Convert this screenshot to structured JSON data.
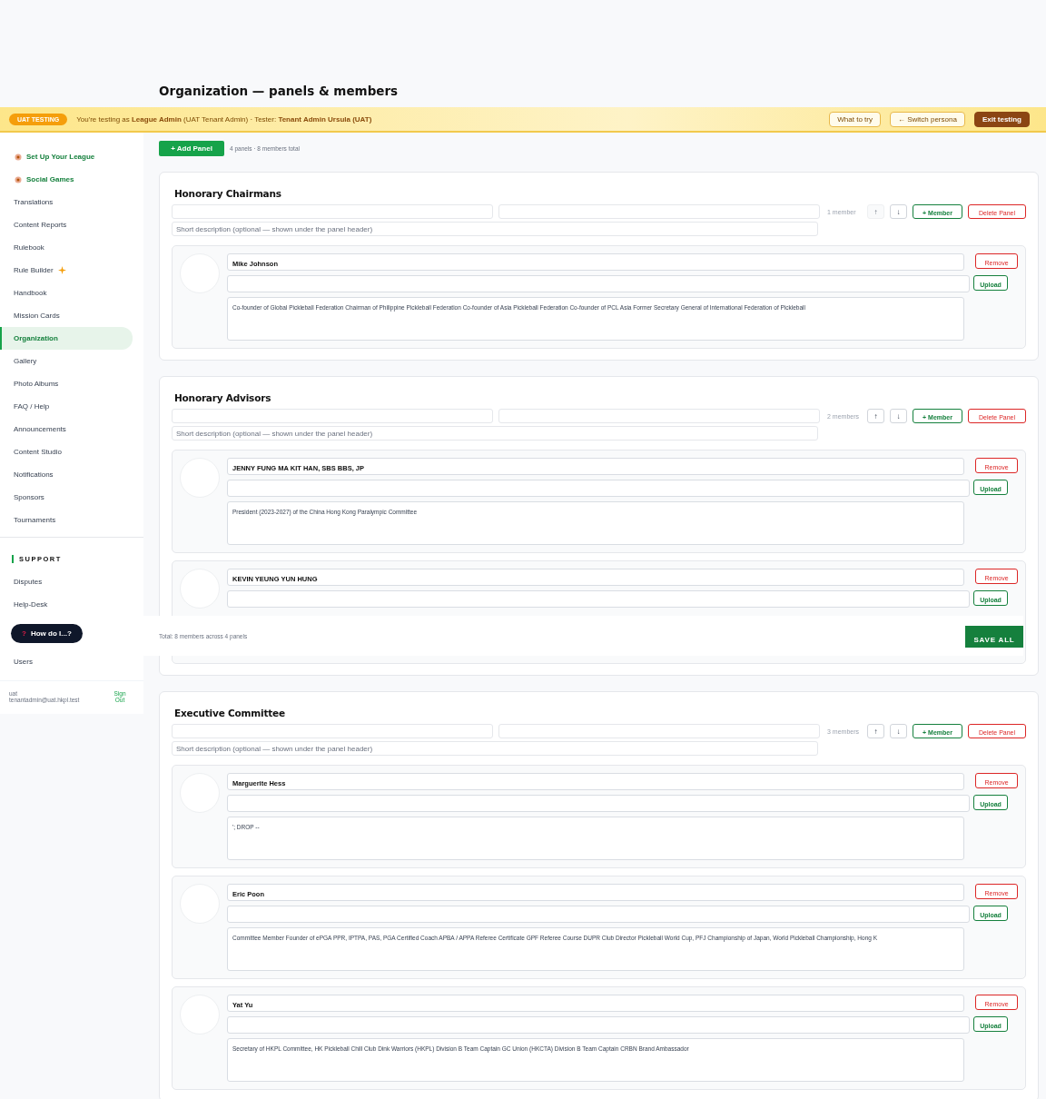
{
  "page_title": "Organization — panels & members",
  "uat_banner": {
    "badge": "UAT TESTING",
    "message": "You're testing as **League Admin** (UAT Tenant Admin) · Tester: **Tenant Admin Ursula (UAT)**",
    "buttons": [
      {
        "label": "What to try",
        "kind": "outline"
      },
      {
        "label": "← Switch persona",
        "kind": "outline"
      },
      {
        "label": "Exit testing",
        "kind": "primary"
      }
    ]
  },
  "sidebar": {
    "items": [
      {
        "label": "Set Up Your League",
        "kind": "feature",
        "selected": false
      },
      {
        "label": "Social Games",
        "kind": "feature",
        "selected": false
      },
      {
        "label": "Translations",
        "kind": "link",
        "selected": false
      },
      {
        "label": "Content Reports",
        "kind": "link",
        "selected": false
      },
      {
        "label": "Rulebook",
        "kind": "link",
        "selected": false
      },
      {
        "label": "Rule Builder",
        "kind": "sparkle",
        "selected": false
      },
      {
        "label": "Handbook",
        "kind": "link",
        "selected": false
      },
      {
        "label": "Mission Cards",
        "kind": "link",
        "selected": false
      },
      {
        "label": "Organization",
        "kind": "link",
        "selected": true
      },
      {
        "label": "Gallery",
        "kind": "link",
        "selected": false
      },
      {
        "label": "Photo Albums",
        "kind": "link",
        "selected": false
      },
      {
        "label": "FAQ / Help",
        "kind": "link",
        "selected": false
      },
      {
        "label": "Announcements",
        "kind": "link",
        "selected": false
      },
      {
        "label": "Content Studio",
        "kind": "link",
        "selected": false
      },
      {
        "label": "Notifications",
        "kind": "link",
        "selected": false
      },
      {
        "label": "Sponsors",
        "kind": "link",
        "selected": false
      },
      {
        "label": "Tournaments",
        "kind": "link",
        "selected": false
      }
    ],
    "support_heading": "SUPPORT",
    "support_items": [
      {
        "label": "Disputes",
        "selected": false
      },
      {
        "label": "Help-Desk",
        "selected": false
      }
    ],
    "help_button": {
      "icon": "?",
      "label": "How do I...?"
    },
    "footer_items": [
      {
        "label": "Users",
        "selected": false
      }
    ],
    "user": {
      "name": "uat",
      "email": "tenantadmin@uat.hkpl.test"
    },
    "sign_out": "Sign Out"
  },
  "toolbar": {
    "add_button": "+ Add Panel",
    "summary": "4 panels · 8 members total"
  },
  "panels": [
    {
      "title": "Honorary Chairmans",
      "description_placeholder": "Short description (optional — shown under the panel header)",
      "count": "1 member",
      "move_up": {
        "label": "↑",
        "disabled": true
      },
      "move_down": {
        "label": "↓",
        "disabled": false
      },
      "add_member": "+ Member",
      "delete": "Delete Panel",
      "members": [
        {
          "name": "Mike Johnson",
          "upload": "Upload",
          "remove": "Remove",
          "bio": "Co-founder of Global Pickleball Federation Chairman of Philippine Pickleball Federation Co-founder of Asia Pickleball Federation Co-founder of PCL Asia Former Secretary General of International Federation of Pickleball"
        }
      ]
    },
    {
      "title": "Honorary Advisors",
      "description_placeholder": "Short description (optional — shown under the panel header)",
      "count": "2 members",
      "move_up": {
        "label": "↑",
        "disabled": false
      },
      "move_down": {
        "label": "↓",
        "disabled": false
      },
      "add_member": "+ Member",
      "delete": "Delete Panel",
      "members": [
        {
          "name": "JENNY FUNG MA KIT HAN, SBS BBS, JP",
          "upload": "Upload",
          "remove": "Remove",
          "bio": "President (2023-2027) of the China Hong Kong Paralympic Committee"
        },
        {
          "name": "KEVIN YEUNG YUN HUNG",
          "upload": "Upload",
          "remove": "Remove"
        }
      ]
    },
    {
      "title": "Executive Committee",
      "description_placeholder": "Short description (optional — shown under the panel header)",
      "count": "3 members",
      "move_up": {
        "label": "↑",
        "disabled": false
      },
      "move_down": {
        "label": "↓",
        "disabled": false
      },
      "add_member": "+ Member",
      "delete": "Delete Panel",
      "members": [
        {
          "name": "Marguerite Hess",
          "upload": "Upload",
          "remove": "Remove",
          "bio": "'; DROP --"
        },
        {
          "name": "Eric Poon",
          "upload": "Upload",
          "remove": "Remove",
          "bio": "Committee Member Founder of ePGA PPR, IPTPA, PAS, PGA Certified Coach APBA / APPA Referee Certificate GPF Referee Course DUPR Club Director Pickleball World Cup, PFJ Championship of Japan, World Pickleball Championship, Hong K"
        },
        {
          "name": "Yat Yu",
          "upload": "Upload",
          "remove": "Remove",
          "bio": "Secretary of HKPL Committee, HK Pickleball Chill Club Dink Warriors (HKPL) Division B Team Captain GC Union (HKCTA) Division B Team Captain CRBN Brand Ambassador"
        }
      ]
    }
  ],
  "save_bar": {
    "summary": "Total: 8 members across 4 panels",
    "save_button": "SAVE ALL"
  }
}
